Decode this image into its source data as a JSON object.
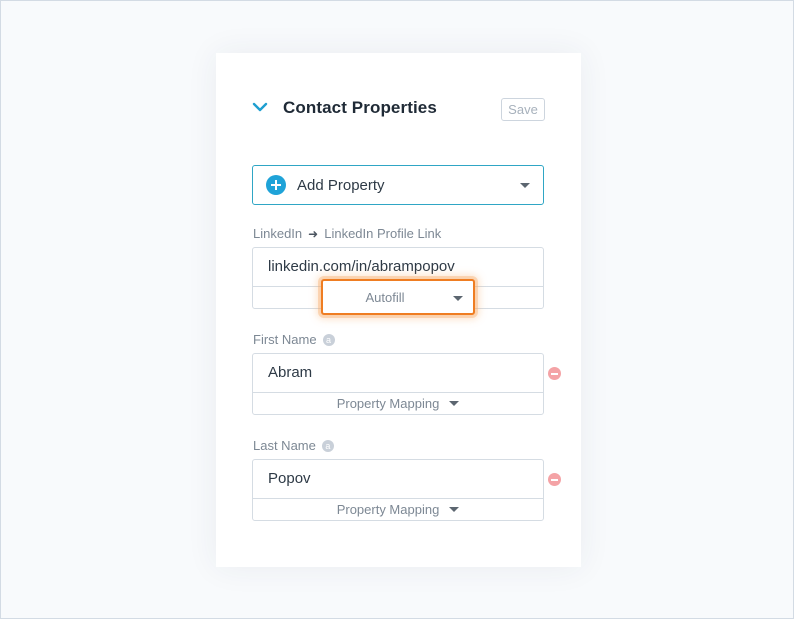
{
  "panel": {
    "title": "Contact Properties",
    "save_label": "Save",
    "add_property_label": "Add Property"
  },
  "fields": {
    "linkedin": {
      "source_label": "LinkedIn",
      "arrow": "➜",
      "target_label": "LinkedIn Profile Link",
      "value": "linkedin.com/in/abrampopov",
      "mapping": "Autofill"
    },
    "first_name": {
      "label": "First Name",
      "badge": "a",
      "value": "Abram",
      "mapping": "Property Mapping"
    },
    "last_name": {
      "label": "Last Name",
      "badge": "a",
      "value": "Popov",
      "mapping": "Property Mapping"
    }
  },
  "colors": {
    "accent": "#1fa3d8",
    "highlight": "#ef7d22",
    "remove": "#f4a3a6"
  }
}
